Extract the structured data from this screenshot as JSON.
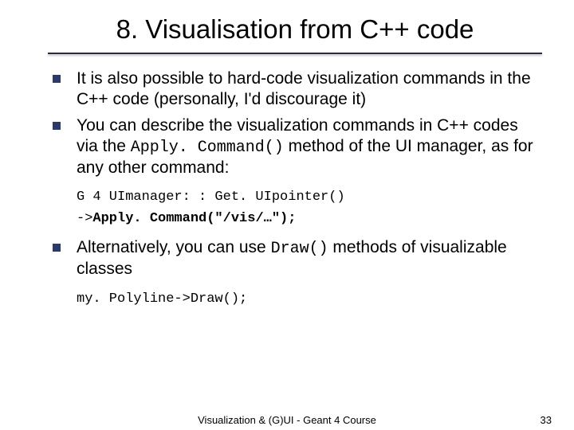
{
  "title": "8. Visualisation from C++ code",
  "bullets": {
    "b1": {
      "pre": "It is also possible to ",
      "em": "hard-code visualization commands",
      "post": " in the C++ code (personally, I'd discourage it)"
    },
    "b2": {
      "pre": "You can describe the visualization commands in C++ codes via the ",
      "code": "Apply. Command()",
      "post": " method of the UI manager, as for any other command:"
    },
    "code1_line1": "G 4 UImanager: : Get. UIpointer()",
    "code1_line2_pre": "->",
    "code1_line2_bold": "Apply. Command(\"/vis/…\");",
    "b3": {
      "pre": "Alternatively, you can use ",
      "code": "Draw()",
      "post": " methods of visualizable classes"
    },
    "code2": "my. Polyline->Draw();"
  },
  "footer": {
    "center": "Visualization & (G)UI - Geant 4 Course",
    "page": "33"
  }
}
